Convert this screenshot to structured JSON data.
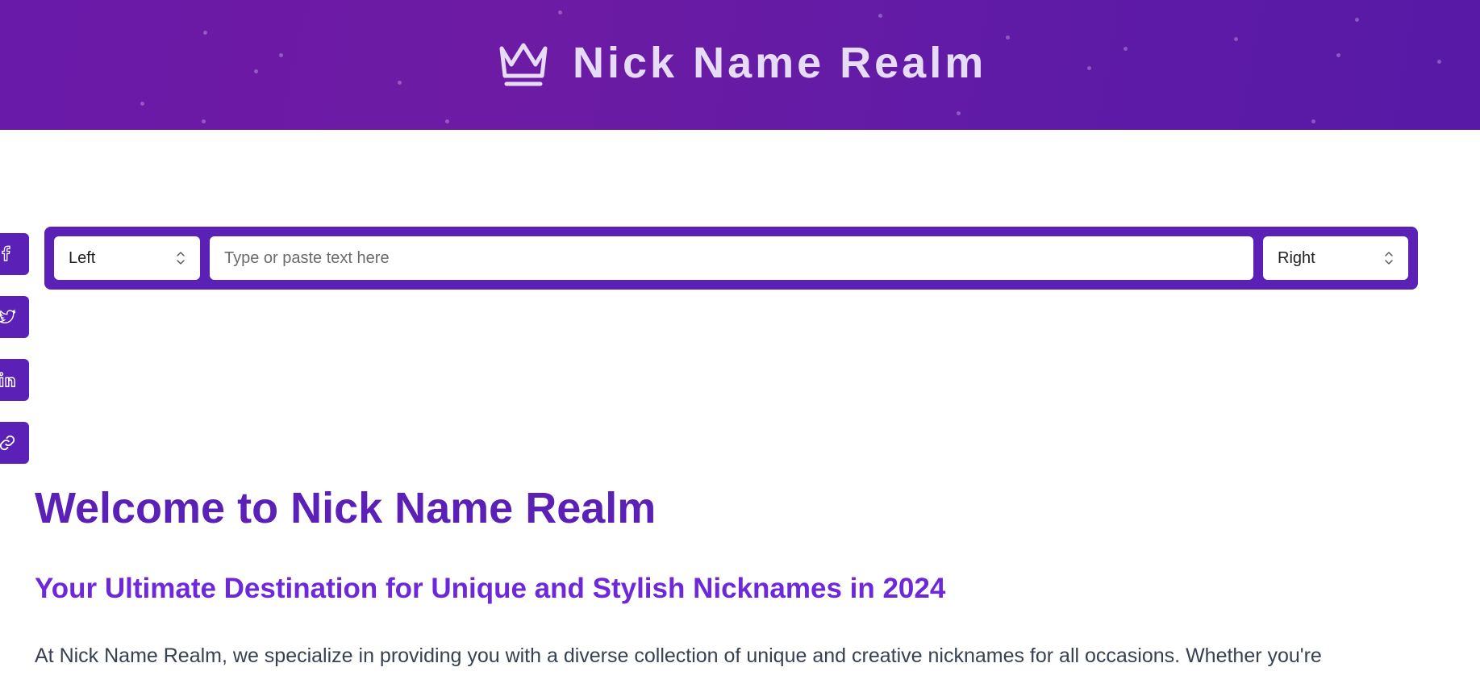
{
  "header": {
    "title": "Nick Name Realm",
    "logo_icon": "crown-icon",
    "gradient": [
      "#6a1aa8",
      "#5719a6"
    ]
  },
  "share": {
    "items": [
      {
        "icon": "facebook-icon"
      },
      {
        "icon": "twitter-icon"
      },
      {
        "icon": "linkedin-icon"
      },
      {
        "icon": "link-icon"
      }
    ]
  },
  "converter": {
    "left_select": {
      "selected": "Left"
    },
    "input": {
      "value": "",
      "placeholder": "Type or paste text here"
    },
    "right_select": {
      "selected": "Right"
    },
    "accent": "#5b21b6"
  },
  "content": {
    "heading": "Welcome to Nick Name Realm",
    "subheading": "Your Ultimate Destination for Unique and Stylish Nicknames in 2024",
    "intro": "At Nick Name Realm, we specialize in providing you with a diverse collection of unique and creative nicknames for all occasions. Whether you're"
  }
}
